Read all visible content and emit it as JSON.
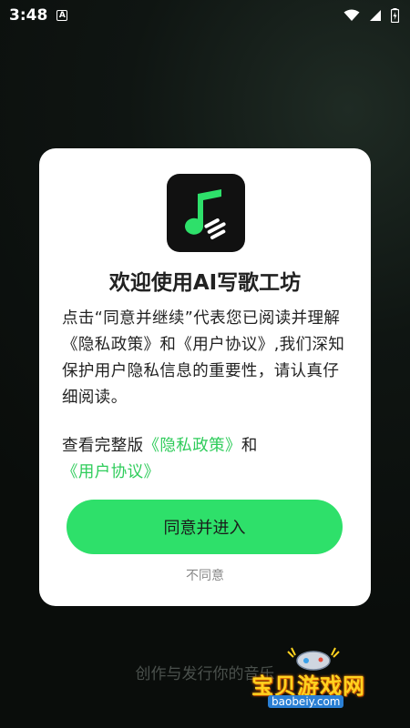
{
  "status_bar": {
    "time": "3:48",
    "notification_icon": "a-notification-icon",
    "icons": [
      "wifi-icon",
      "signal-icon",
      "battery-icon"
    ]
  },
  "dialog": {
    "app_icon": "music-note-icon",
    "title": "欢迎使用AI写歌工坊",
    "body": "点击“同意并继续”代表您已阅读并理解《隐私政策》和《用户协议》,我们深知保护用户隐私信息的重要性，请认真仔细阅读。",
    "links_prefix": "查看完整版",
    "privacy_link": "《隐私政策》",
    "links_and": "和",
    "user_agreement_link": "《用户协议》",
    "agree_button": "同意并进入",
    "disagree_link": "不同意",
    "accent_color": "#2ee06a"
  },
  "background": {
    "slogan": "创作与发行你的音乐"
  },
  "watermark": {
    "text": "宝贝游戏网",
    "url": "baobeiy.com"
  }
}
